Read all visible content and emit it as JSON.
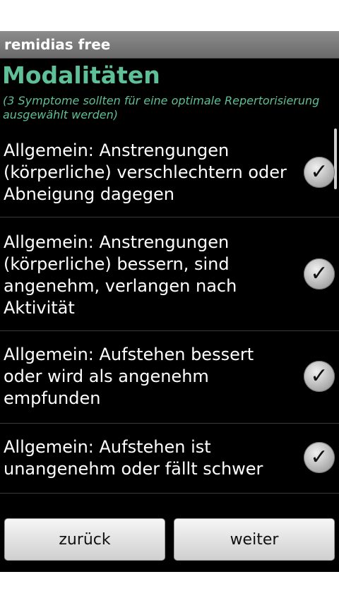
{
  "app": {
    "title": "remidias free"
  },
  "page": {
    "heading": "Modalitäten",
    "subtitle": "(3 Symptome sollten für eine optimale Repertorisierung ausgewählt werden)"
  },
  "items": [
    {
      "text": "Allgemein:  Anstrengungen (körperliche) verschlechtern oder Abneigung dagegen",
      "checked": true
    },
    {
      "text": "Allgemein: Anstrengungen (körperliche) bessern, sind angenehm, verlangen nach Aktivität",
      "checked": true
    },
    {
      "text": "Allgemein: Aufstehen bessert oder wird als angenehm empfunden",
      "checked": true
    },
    {
      "text": "Allgemein: Aufstehen ist unangenehm oder fällt schwer",
      "checked": true
    }
  ],
  "buttons": {
    "back": "zurück",
    "next": "weiter"
  },
  "icons": {
    "check": "check-icon"
  }
}
